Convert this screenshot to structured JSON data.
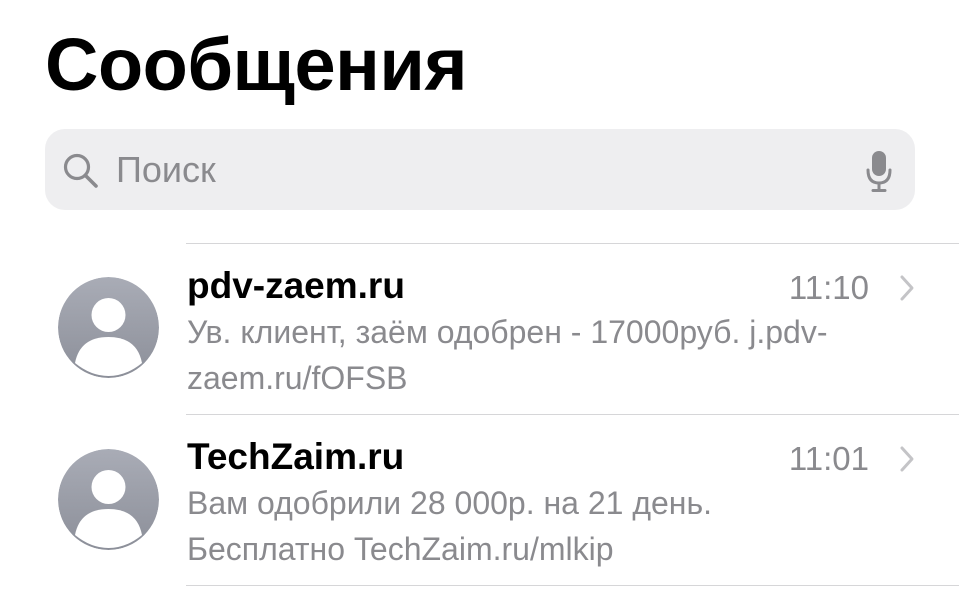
{
  "header": {
    "title": "Сообщения"
  },
  "search": {
    "placeholder": "Поиск",
    "value": "",
    "icon": "magnifier-icon",
    "voice_icon": "microphone-icon"
  },
  "messages": [
    {
      "sender": "pdv-zaem.ru",
      "time": "11:10",
      "preview_line1": "Ув. клиент, заём одобрен - 17000руб. j.pdv-",
      "preview_line2": "zaem.ru/fOFSB",
      "avatar_icon": "person-icon"
    },
    {
      "sender": "TechZaim.ru",
      "time": "11:01",
      "preview_line1": "Вам одобрили 28 000р. на 21 день.",
      "preview_line2": "Бесплатно TechZaim.ru/mlkip",
      "avatar_icon": "person-icon"
    }
  ],
  "colors": {
    "background": "#ffffff",
    "search_field": "#eeeef0",
    "secondary_text": "#8a8a8e",
    "divider": "#d6d6d8",
    "avatar_gradient_top": "#a9acb6",
    "avatar_gradient_bottom": "#8c8f99"
  }
}
